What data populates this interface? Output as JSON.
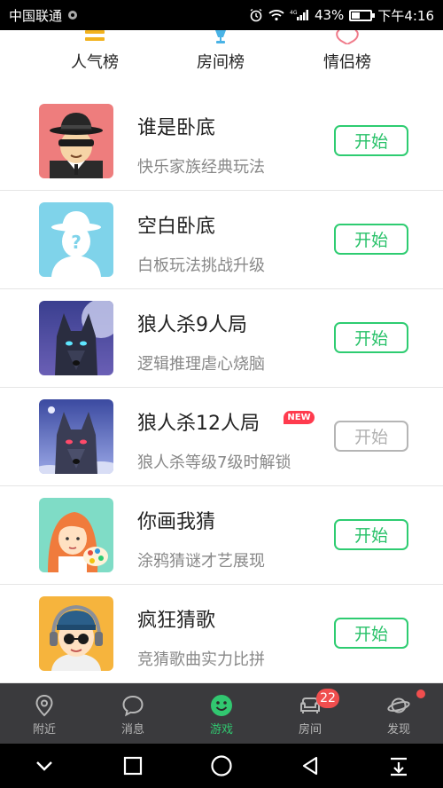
{
  "status_bar": {
    "carrier": "中国联通",
    "network": "4G",
    "battery_text": "43%",
    "battery_level": 0.43,
    "time": "下午4:16"
  },
  "categories": [
    {
      "label": "人气榜",
      "icon": "popularity-icon",
      "color": "#f2b21e"
    },
    {
      "label": "房间榜",
      "icon": "room-trophy-icon",
      "color": "#4ab3e6"
    },
    {
      "label": "情侣榜",
      "icon": "heart-icon",
      "color": "#f07b8a"
    }
  ],
  "games": [
    {
      "title": "谁是卧底",
      "desc": "快乐家族经典玩法",
      "button": "开始",
      "enabled": true
    },
    {
      "title": "空白卧底",
      "desc": "白板玩法挑战升级",
      "button": "开始",
      "enabled": true
    },
    {
      "title": "狼人杀9人局",
      "desc": "逻辑推理虐心烧脑",
      "button": "开始",
      "enabled": true
    },
    {
      "title": "狼人杀12人局",
      "desc": "狼人杀等级7级时解锁",
      "button": "开始",
      "enabled": false,
      "badge": "NEW"
    },
    {
      "title": "你画我猜",
      "desc": "涂鸦猜谜才艺展现",
      "button": "开始",
      "enabled": true
    },
    {
      "title": "疯狂猜歌",
      "desc": "竞猜歌曲实力比拼",
      "button": "开始",
      "enabled": true
    }
  ],
  "tabs": [
    {
      "label": "附近",
      "icon": "location-pin-icon"
    },
    {
      "label": "消息",
      "icon": "chat-bubble-icon"
    },
    {
      "label": "游戏",
      "icon": "smiley-icon",
      "active": true
    },
    {
      "label": "房间",
      "icon": "sofa-icon",
      "badge": "22"
    },
    {
      "label": "发现",
      "icon": "planet-icon",
      "dot": true
    }
  ],
  "colors": {
    "accent": "#2ecc71",
    "tab_bar": "#3a3a3d",
    "badge": "#f04e4e"
  }
}
